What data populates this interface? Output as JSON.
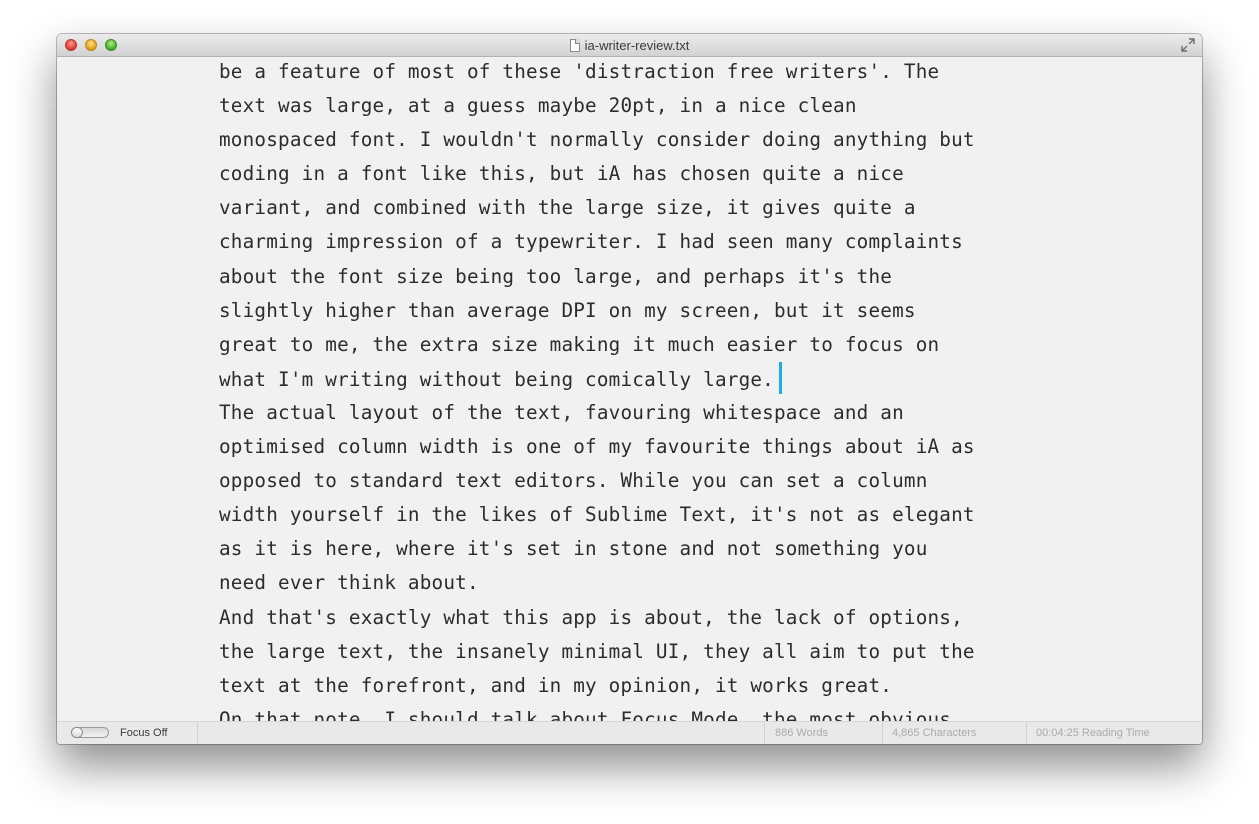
{
  "window": {
    "title": "ia-writer-review.txt",
    "icons": {
      "close": "close-icon",
      "minimize": "minimize-icon",
      "zoom": "zoom-icon",
      "document": "document-icon",
      "fullscreen": "fullscreen-icon"
    }
  },
  "editor": {
    "lines": [
      "be a feature of most of these 'distraction free writers'. The",
      "text was large, at a guess maybe 20pt, in a nice clean",
      "monospaced font. I wouldn't normally consider doing anything but",
      "coding in a font like this, but iA has chosen quite a nice",
      "variant, and combined with the large size, it gives quite a",
      "charming impression of a typewriter. I had seen many complaints",
      "about the font size being too large, and perhaps it's the",
      "slightly higher than average DPI on my screen, but it seems",
      "great to me, the extra size making it much easier to focus on",
      "what I'm writing without being comically large.",
      "The actual layout of the text, favouring whitespace and an",
      "optimised column width is one of my favourite things about iA as",
      "opposed to standard text editors. While you can set a column",
      "width yourself in the likes of Sublime Text, it's not as elegant",
      "as it is here, where it's set in stone and not something you",
      "need ever think about.",
      "And that's exactly what this app is about, the lack of options,",
      "the large text, the insanely minimal UI, they all aim to put the",
      "text at the forefront, and in my opinion, it works great.",
      "On that note, I should talk about Focus Mode, the most obvious"
    ],
    "cursor_color": "#22a9e7",
    "text_color": "#2c2c2c",
    "background_color": "#f1f1f1"
  },
  "status": {
    "focus_label": "Focus Off",
    "focus_on": false,
    "words": "886 Words",
    "characters": "4,865 Characters",
    "reading_time": "00:04:25 Reading Time"
  }
}
